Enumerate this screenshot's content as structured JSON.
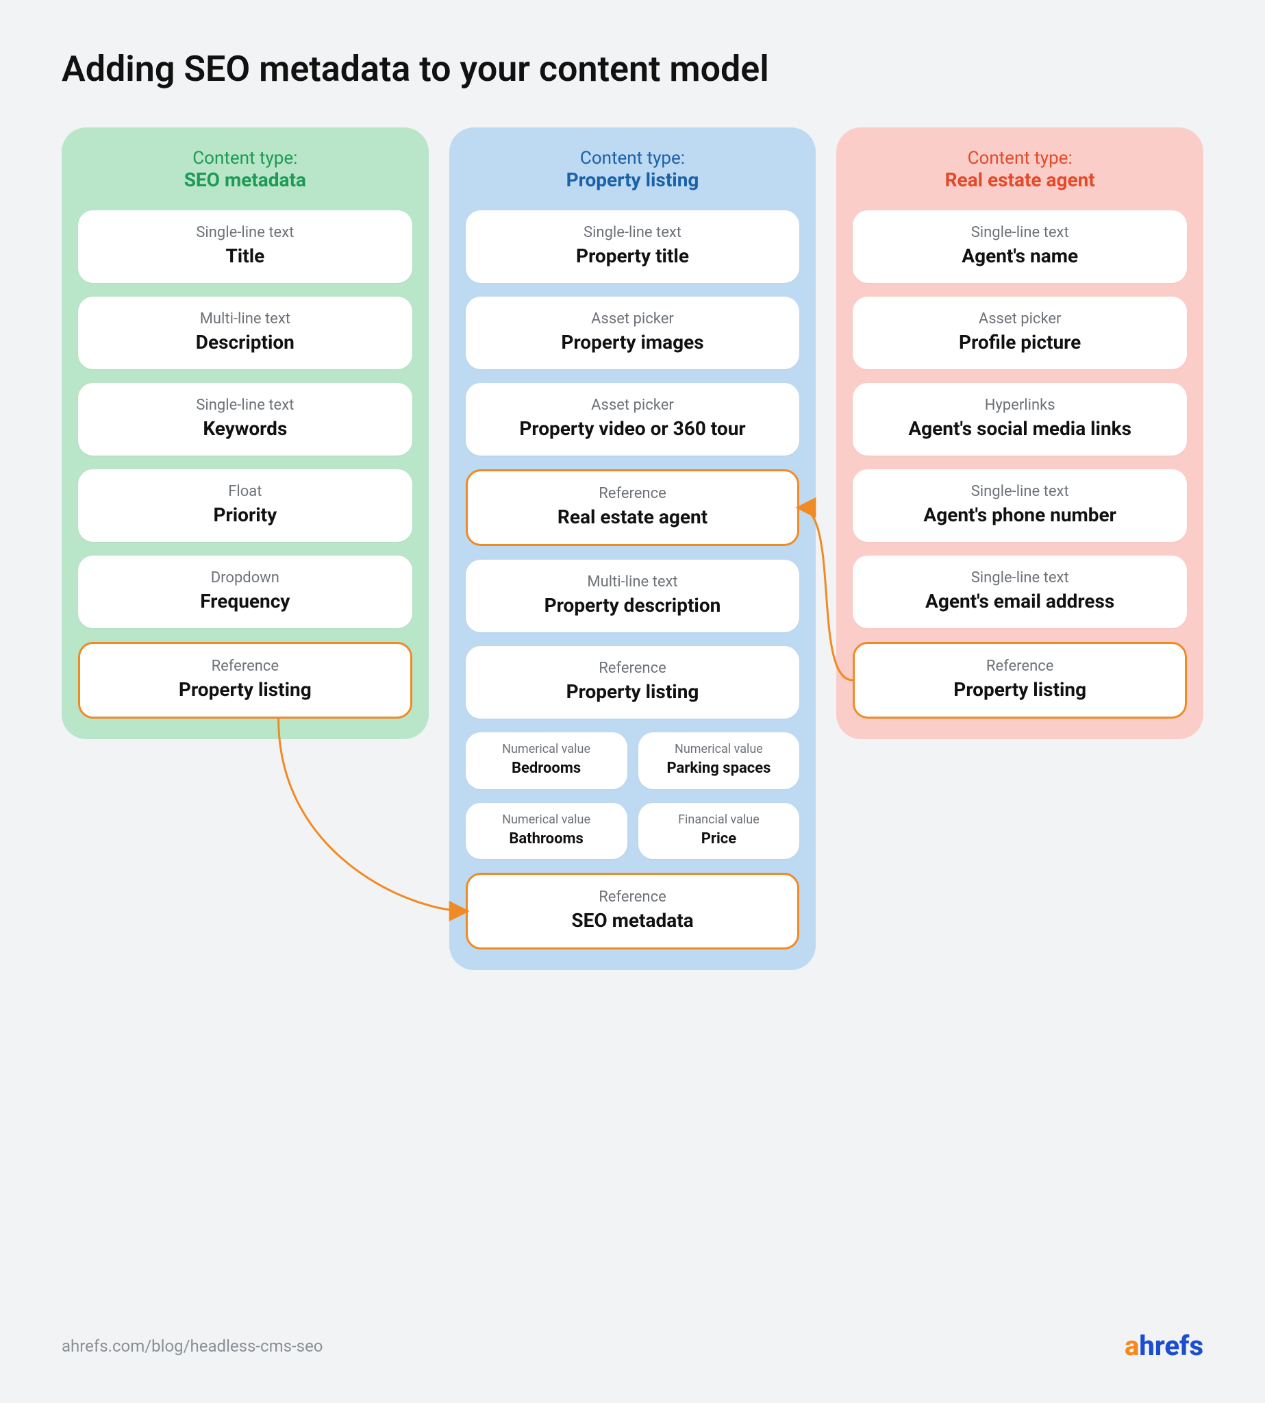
{
  "title": "Adding SEO metadata to your content model",
  "columns": [
    {
      "header_pre": "Content type:",
      "header_name": "SEO metadata",
      "color": "green",
      "fields": [
        {
          "type": "Single-line text",
          "name": "Title"
        },
        {
          "type": "Multi-line text",
          "name": "Description"
        },
        {
          "type": "Single-line text",
          "name": "Keywords"
        },
        {
          "type": "Float",
          "name": "Priority"
        },
        {
          "type": "Dropdown",
          "name": "Frequency"
        },
        {
          "type": "Reference",
          "name": "Property listing",
          "highlight": true
        }
      ]
    },
    {
      "header_pre": "Content type:",
      "header_name": "Property listing",
      "color": "blue",
      "fields": [
        {
          "type": "Single-line text",
          "name": "Property title"
        },
        {
          "type": "Asset picker",
          "name": "Property images"
        },
        {
          "type": "Asset picker",
          "name": "Property video or 360 tour"
        },
        {
          "type": "Reference",
          "name": "Real estate agent",
          "highlight": true
        },
        {
          "type": "Multi-line text",
          "name": "Property description"
        },
        {
          "type": "Reference",
          "name": "Property listing"
        },
        [
          {
            "type": "Numerical value",
            "name": "Bedrooms"
          },
          {
            "type": "Numerical value",
            "name": "Parking spaces"
          }
        ],
        [
          {
            "type": "Numerical value",
            "name": "Bathrooms"
          },
          {
            "type": "Financial value",
            "name": "Price"
          }
        ],
        {
          "type": "Reference",
          "name": "SEO metadata",
          "highlight": true
        }
      ]
    },
    {
      "header_pre": "Content type:",
      "header_name": "Real estate agent",
      "color": "red",
      "fields": [
        {
          "type": "Single-line text",
          "name": "Agent's name"
        },
        {
          "type": "Asset picker",
          "name": "Profile picture"
        },
        {
          "type": "Hyperlinks",
          "name": "Agent's social media links"
        },
        {
          "type": "Single-line text",
          "name": "Agent's phone number"
        },
        {
          "type": "Single-line text",
          "name": "Agent's email address"
        },
        {
          "type": "Reference",
          "name": "Property listing",
          "highlight": true
        }
      ]
    }
  ],
  "footer": {
    "url": "ahrefs.com/blog/headless-cms-seo",
    "logo_a": "a",
    "logo_rest": "hrefs"
  },
  "connectors": [
    {
      "from": "SEO metadata / Property listing",
      "to": "Property listing / SEO metadata"
    },
    {
      "from": "Real estate agent / Property listing",
      "to": "Property listing / Real estate agent"
    }
  ]
}
